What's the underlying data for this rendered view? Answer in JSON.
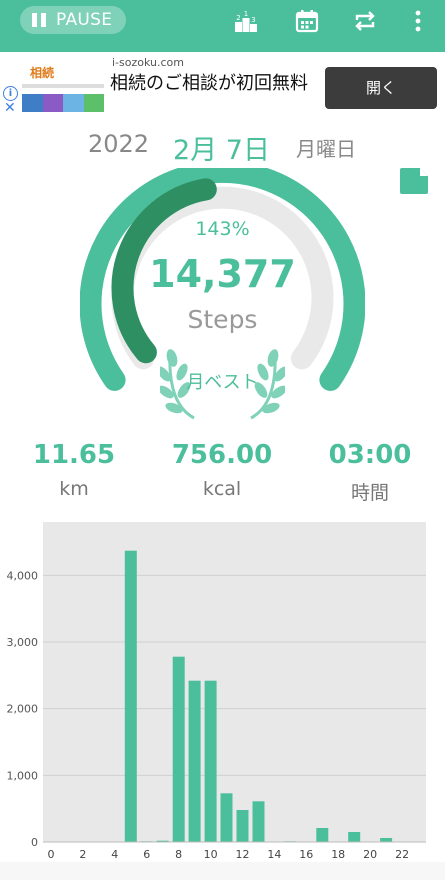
{
  "toolbar": {
    "pause_label": "PAUSE",
    "icons": [
      "pause-icon",
      "ranking-icon",
      "calendar-icon",
      "repeat-icon",
      "more-vert-icon"
    ]
  },
  "ad": {
    "brand": "相続",
    "domain": "i-sozoku.com",
    "headline": "相続のご相談が初回無料",
    "button_label": "開く"
  },
  "date": {
    "year": "2022",
    "month_day": "2月 7日",
    "weekday": "月曜日"
  },
  "progress": {
    "percent_text": "143%",
    "steps": "14,377",
    "steps_unit": "Steps",
    "badge": "月ベスト",
    "fraction": 1.43
  },
  "stats": [
    {
      "value": "11.65",
      "unit": "km"
    },
    {
      "value": "756.00",
      "unit": "kcal"
    },
    {
      "value": "03:00",
      "unit": "時間"
    }
  ],
  "colors": {
    "accent": "#4bbf9b",
    "accent_dark": "#2d8f62",
    "track": "#e9e9e9",
    "bar": "#4bbf9b",
    "chart_bg": "#e8e8e8"
  },
  "chart_data": {
    "type": "bar",
    "x": [
      0,
      1,
      2,
      3,
      4,
      5,
      6,
      7,
      8,
      9,
      10,
      11,
      12,
      13,
      14,
      15,
      16,
      17,
      18,
      19,
      20,
      21,
      22,
      23
    ],
    "values": [
      0,
      0,
      0,
      0,
      0,
      4370,
      10,
      20,
      2780,
      2420,
      2420,
      730,
      480,
      610,
      0,
      10,
      0,
      210,
      0,
      150,
      0,
      60,
      0,
      0
    ],
    "xticks": [
      "0",
      "2",
      "4",
      "6",
      "8",
      "10",
      "12",
      "14",
      "16",
      "18",
      "20",
      "22"
    ],
    "yticks": [
      "0",
      "1,000",
      "2,000",
      "3,000",
      "4,000"
    ],
    "ylim": [
      0,
      4800
    ],
    "grid": true
  }
}
